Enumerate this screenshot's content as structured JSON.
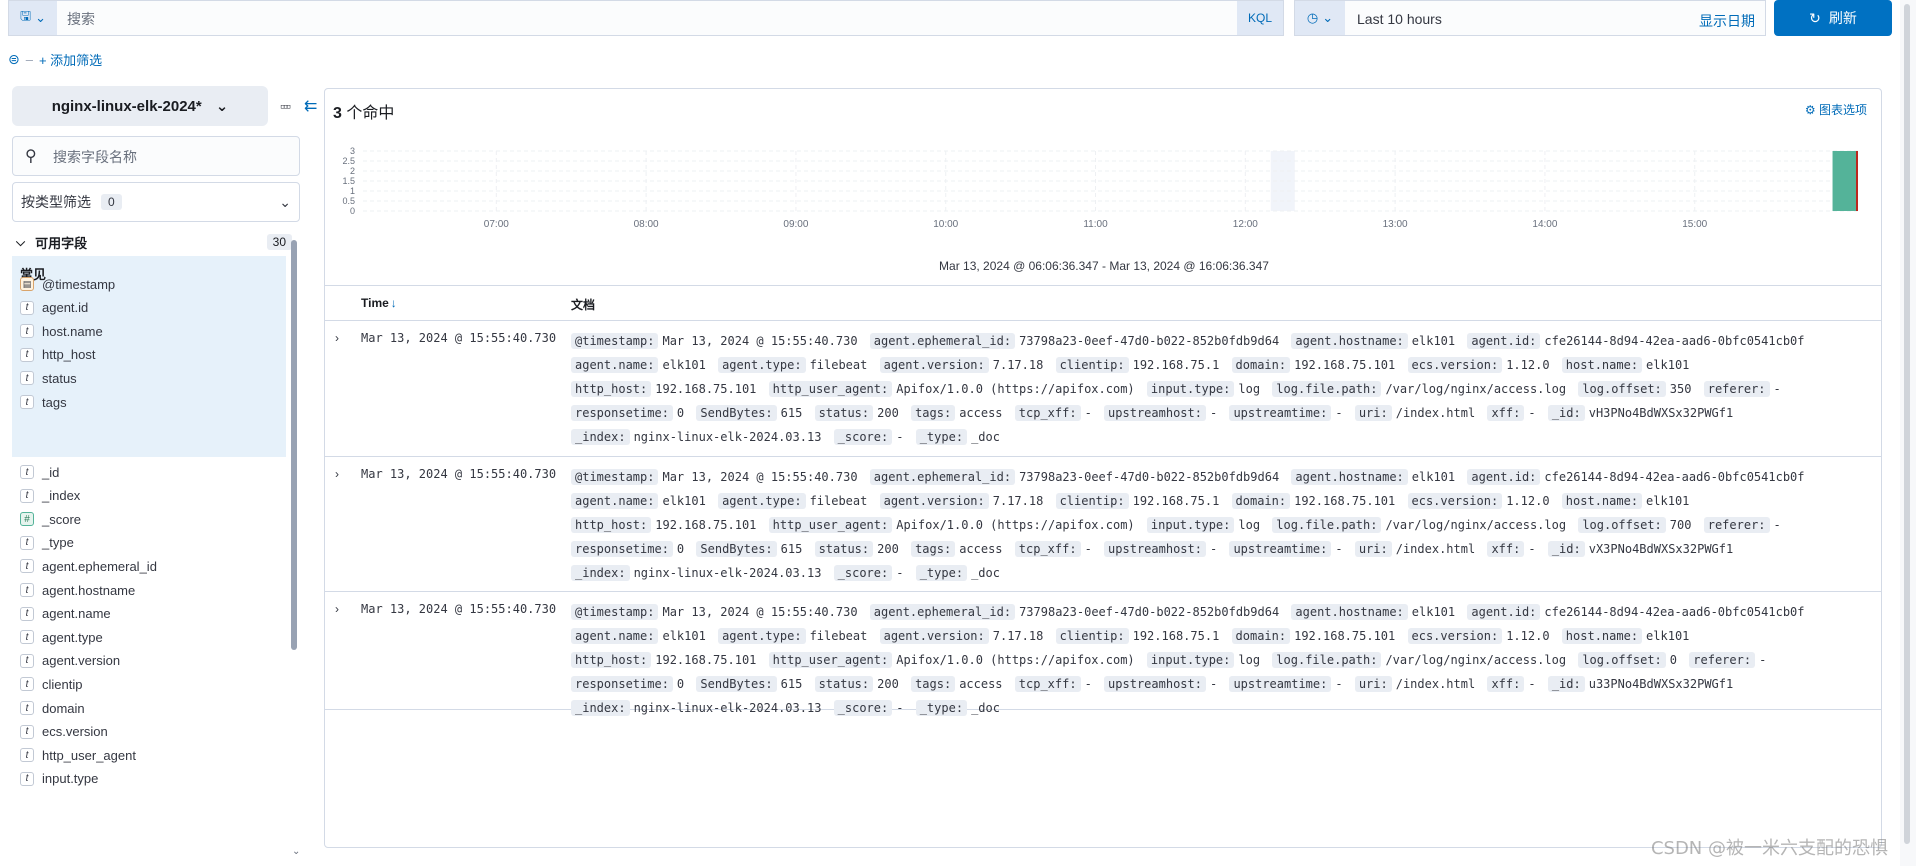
{
  "query_bar": {
    "placeholder": "搜索",
    "language": "KQL",
    "time_range": "Last 10 hours",
    "show_dates": "显示日期",
    "refresh": "刷新"
  },
  "filter": {
    "add_filter": "+ 添加筛选"
  },
  "sidebar": {
    "index_pattern": "nginx-linux-elk-2024*",
    "field_search_placeholder": "搜索字段名称",
    "type_filter_label": "按类型筛选",
    "type_filter_count": "0",
    "available_fields_label": "可用字段",
    "available_fields_count": "30",
    "popular_label": "常见",
    "popular_fields": [
      {
        "name": "@timestamp",
        "type": "date"
      },
      {
        "name": "agent.id",
        "type": "t"
      },
      {
        "name": "host.name",
        "type": "t"
      },
      {
        "name": "http_host",
        "type": "t"
      },
      {
        "name": "status",
        "type": "t"
      },
      {
        "name": "tags",
        "type": "t"
      }
    ],
    "fields": [
      {
        "name": "_id",
        "type": "t"
      },
      {
        "name": "_index",
        "type": "t"
      },
      {
        "name": "_score",
        "type": "#"
      },
      {
        "name": "_type",
        "type": "t"
      },
      {
        "name": "agent.ephemeral_id",
        "type": "t"
      },
      {
        "name": "agent.hostname",
        "type": "t"
      },
      {
        "name": "agent.name",
        "type": "t"
      },
      {
        "name": "agent.type",
        "type": "t"
      },
      {
        "name": "agent.version",
        "type": "t"
      },
      {
        "name": "clientip",
        "type": "t"
      },
      {
        "name": "domain",
        "type": "t"
      },
      {
        "name": "ecs.version",
        "type": "t"
      },
      {
        "name": "http_user_agent",
        "type": "t"
      },
      {
        "name": "input.type",
        "type": "t"
      }
    ]
  },
  "main": {
    "hits_count": "3",
    "hits_label": "个命中",
    "chart_options": "图表选项",
    "range_caption": "Mar 13, 2024 @ 06:06:36.347 - Mar 13, 2024 @ 16:06:36.347",
    "col_time": "Time",
    "col_doc": "文档"
  },
  "chart_data": {
    "type": "bar",
    "y_ticks": [
      "3",
      "2.5",
      "2",
      "1.5",
      "1",
      "0.5",
      "0"
    ],
    "x_ticks": [
      "07:00",
      "08:00",
      "09:00",
      "10:00",
      "11:00",
      "12:00",
      "13:00",
      "14:00",
      "15:00"
    ],
    "ylim": [
      0,
      3
    ],
    "x_range_hours": [
      6.11,
      16.11
    ],
    "bars": [
      {
        "x_hour": 15.92,
        "value": 3
      }
    ],
    "bar_color": "#54b399",
    "now_marker_hour": 16.11,
    "now_marker_color": "#bd271e",
    "highlight_band_hours": [
      12.17,
      12.33
    ]
  },
  "docs": [
    {
      "time": "Mar 13, 2024 @ 15:55:40.730",
      "fields": [
        [
          "@timestamp:",
          "Mar 13, 2024 @ 15:55:40.730"
        ],
        [
          "agent.ephemeral_id:",
          "73798a23-0eef-47d0-b022-852b0fdb9d64"
        ],
        [
          "agent.hostname:",
          "elk101"
        ],
        [
          "agent.id:",
          "cfe26144-8d94-42ea-aad6-0bfc0541cb0f"
        ],
        [
          "agent.name:",
          "elk101"
        ],
        [
          "agent.type:",
          "filebeat"
        ],
        [
          "agent.version:",
          "7.17.18"
        ],
        [
          "clientip:",
          "192.168.75.1"
        ],
        [
          "domain:",
          "192.168.75.101"
        ],
        [
          "ecs.version:",
          "1.12.0"
        ],
        [
          "host.name:",
          "elk101"
        ],
        [
          "http_host:",
          "192.168.75.101"
        ],
        [
          "http_user_agent:",
          "Apifox/1.0.0 (https://apifox.com)"
        ],
        [
          "input.type:",
          "log"
        ],
        [
          "log.file.path:",
          "/var/log/nginx/access.log"
        ],
        [
          "log.offset:",
          "350"
        ],
        [
          "referer:",
          "-"
        ],
        [
          "responsetime:",
          "0"
        ],
        [
          "SendBytes:",
          "615"
        ],
        [
          "status:",
          "200"
        ],
        [
          "tags:",
          "access"
        ],
        [
          "tcp_xff:",
          "-"
        ],
        [
          "upstreamhost:",
          "-"
        ],
        [
          "upstreamtime:",
          "-"
        ],
        [
          "uri:",
          "/index.html"
        ],
        [
          "xff:",
          "-"
        ],
        [
          "_id:",
          "vH3PNo4BdWXSx32PWGf1"
        ],
        [
          "_index:",
          "nginx-linux-elk-2024.03.13"
        ],
        [
          "_score:",
          "-"
        ],
        [
          "_type:",
          "_doc"
        ]
      ]
    },
    {
      "time": "Mar 13, 2024 @ 15:55:40.730",
      "fields": [
        [
          "@timestamp:",
          "Mar 13, 2024 @ 15:55:40.730"
        ],
        [
          "agent.ephemeral_id:",
          "73798a23-0eef-47d0-b022-852b0fdb9d64"
        ],
        [
          "agent.hostname:",
          "elk101"
        ],
        [
          "agent.id:",
          "cfe26144-8d94-42ea-aad6-0bfc0541cb0f"
        ],
        [
          "agent.name:",
          "elk101"
        ],
        [
          "agent.type:",
          "filebeat"
        ],
        [
          "agent.version:",
          "7.17.18"
        ],
        [
          "clientip:",
          "192.168.75.1"
        ],
        [
          "domain:",
          "192.168.75.101"
        ],
        [
          "ecs.version:",
          "1.12.0"
        ],
        [
          "host.name:",
          "elk101"
        ],
        [
          "http_host:",
          "192.168.75.101"
        ],
        [
          "http_user_agent:",
          "Apifox/1.0.0 (https://apifox.com)"
        ],
        [
          "input.type:",
          "log"
        ],
        [
          "log.file.path:",
          "/var/log/nginx/access.log"
        ],
        [
          "log.offset:",
          "700"
        ],
        [
          "referer:",
          "-"
        ],
        [
          "responsetime:",
          "0"
        ],
        [
          "SendBytes:",
          "615"
        ],
        [
          "status:",
          "200"
        ],
        [
          "tags:",
          "access"
        ],
        [
          "tcp_xff:",
          "-"
        ],
        [
          "upstreamhost:",
          "-"
        ],
        [
          "upstreamtime:",
          "-"
        ],
        [
          "uri:",
          "/index.html"
        ],
        [
          "xff:",
          "-"
        ],
        [
          "_id:",
          "vX3PNo4BdWXSx32PWGf1"
        ],
        [
          "_index:",
          "nginx-linux-elk-2024.03.13"
        ],
        [
          "_score:",
          "-"
        ],
        [
          "_type:",
          "_doc"
        ]
      ]
    },
    {
      "time": "Mar 13, 2024 @ 15:55:40.730",
      "fields": [
        [
          "@timestamp:",
          "Mar 13, 2024 @ 15:55:40.730"
        ],
        [
          "agent.ephemeral_id:",
          "73798a23-0eef-47d0-b022-852b0fdb9d64"
        ],
        [
          "agent.hostname:",
          "elk101"
        ],
        [
          "agent.id:",
          "cfe26144-8d94-42ea-aad6-0bfc0541cb0f"
        ],
        [
          "agent.name:",
          "elk101"
        ],
        [
          "agent.type:",
          "filebeat"
        ],
        [
          "agent.version:",
          "7.17.18"
        ],
        [
          "clientip:",
          "192.168.75.1"
        ],
        [
          "domain:",
          "192.168.75.101"
        ],
        [
          "ecs.version:",
          "1.12.0"
        ],
        [
          "host.name:",
          "elk101"
        ],
        [
          "http_host:",
          "192.168.75.101"
        ],
        [
          "http_user_agent:",
          "Apifox/1.0.0 (https://apifox.com)"
        ],
        [
          "input.type:",
          "log"
        ],
        [
          "log.file.path:",
          "/var/log/nginx/access.log"
        ],
        [
          "log.offset:",
          "0"
        ],
        [
          "referer:",
          "-"
        ],
        [
          "responsetime:",
          "0"
        ],
        [
          "SendBytes:",
          "615"
        ],
        [
          "status:",
          "200"
        ],
        [
          "tags:",
          "access"
        ],
        [
          "tcp_xff:",
          "-"
        ],
        [
          "upstreamhost:",
          "-"
        ],
        [
          "upstreamtime:",
          "-"
        ],
        [
          "uri:",
          "/index.html"
        ],
        [
          "xff:",
          "-"
        ],
        [
          "_id:",
          "u33PNo4BdWXSx32PWGf1"
        ],
        [
          "_index:",
          "nginx-linux-elk-2024.03.13"
        ],
        [
          "_score:",
          "-"
        ],
        [
          "_type:",
          "_doc"
        ]
      ]
    }
  ],
  "watermark": "CSDN @被一米六支配的恐惧"
}
